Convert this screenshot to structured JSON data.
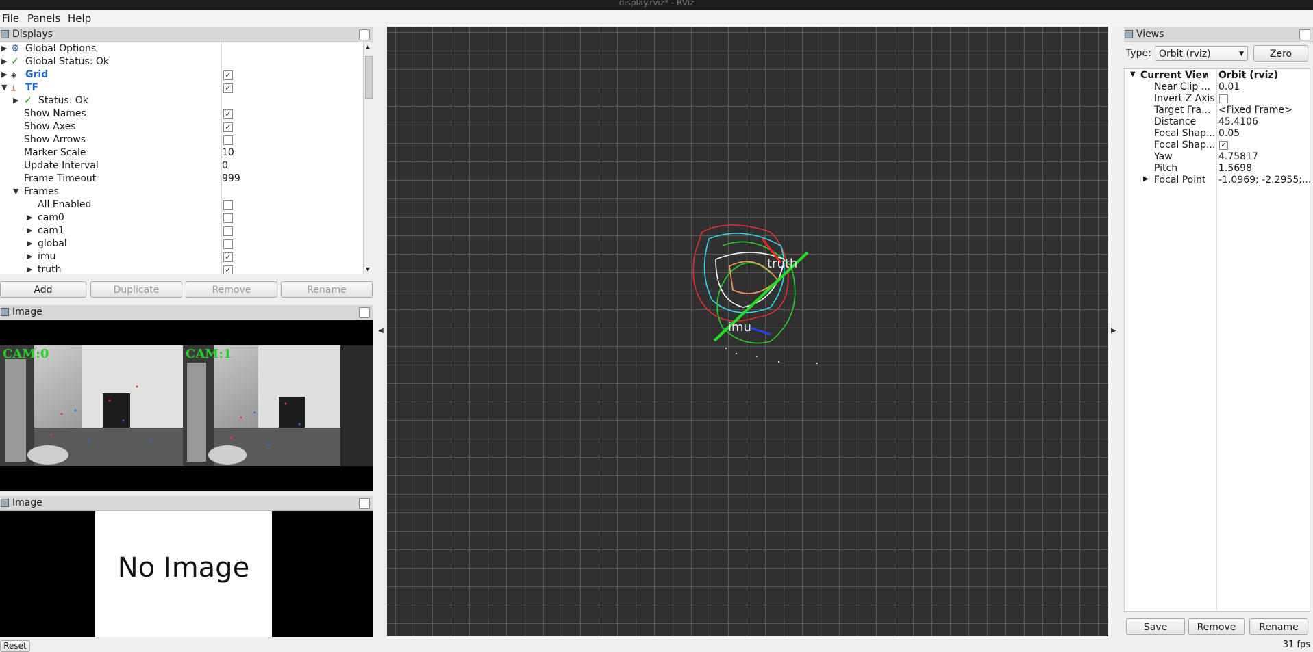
{
  "window": {
    "title": "display.rviz* - RViz"
  },
  "menu": {
    "file": "File",
    "panels": "Panels",
    "help": "Help"
  },
  "displays": {
    "header": "Displays",
    "rows": {
      "global_options": "Global Options",
      "global_status": "Global Status: Ok",
      "grid": "Grid",
      "tf": "TF",
      "status": "Status: Ok",
      "show_names": "Show Names",
      "show_axes": "Show Axes",
      "show_arrows": "Show Arrows",
      "marker_scale": "Marker Scale",
      "marker_scale_value": "10",
      "update_interval": "Update Interval",
      "update_interval_value": "0",
      "frame_timeout": "Frame Timeout",
      "frame_timeout_value": "999",
      "frames": "Frames",
      "all_enabled": "All Enabled",
      "cam0": "cam0",
      "cam1": "cam1",
      "global": "global",
      "imu": "imu",
      "truth": "truth"
    },
    "checks": {
      "grid": true,
      "tf": true,
      "show_names": true,
      "show_axes": true,
      "show_arrows": false,
      "all_enabled": false,
      "cam0": false,
      "cam1": false,
      "global": false,
      "imu": true,
      "truth": true
    },
    "buttons": {
      "add": "Add",
      "duplicate": "Duplicate",
      "remove": "Remove",
      "rename": "Rename"
    }
  },
  "image_panel_1": {
    "header": "Image",
    "cam0_label": "CAM:0",
    "cam1_label": "CAM:1"
  },
  "image_panel_2": {
    "header": "Image",
    "no_image": "No Image"
  },
  "footer": {
    "reset": "Reset",
    "fps": "31 fps"
  },
  "scene": {
    "label_truth": "truth",
    "label_imu": "imu"
  },
  "views": {
    "header": "Views",
    "type_label": "Type:",
    "type_value": "Orbit (rviz)",
    "zero": "Zero",
    "current_view": "Current View",
    "current_view_value": "Orbit (rviz)",
    "props": {
      "near_clip": "Near Clip ...",
      "near_clip_value": "0.01",
      "invert_z": "Invert Z Axis",
      "target_frame": "Target Fra...",
      "target_frame_value": "<Fixed Frame>",
      "distance": "Distance",
      "distance_value": "45.4106",
      "focal_shape_size": "Focal Shap...",
      "focal_shape_size_value": "0.05",
      "focal_shape_fixed": "Focal Shap...",
      "yaw": "Yaw",
      "yaw_value": "4.75817",
      "pitch": "Pitch",
      "pitch_value": "1.5698",
      "focal_point": "Focal Point",
      "focal_point_value": "-1.0969; -2.2955;..."
    },
    "checks": {
      "invert_z": false,
      "focal_shape_fixed": true
    },
    "buttons": {
      "save": "Save",
      "remove": "Remove",
      "rename": "Rename"
    }
  },
  "colors": {
    "accent_blue": "#1b6ac9",
    "ok_green": "#1a8f1a",
    "cam_label": "#23d323",
    "grid_bg": "#303030"
  }
}
